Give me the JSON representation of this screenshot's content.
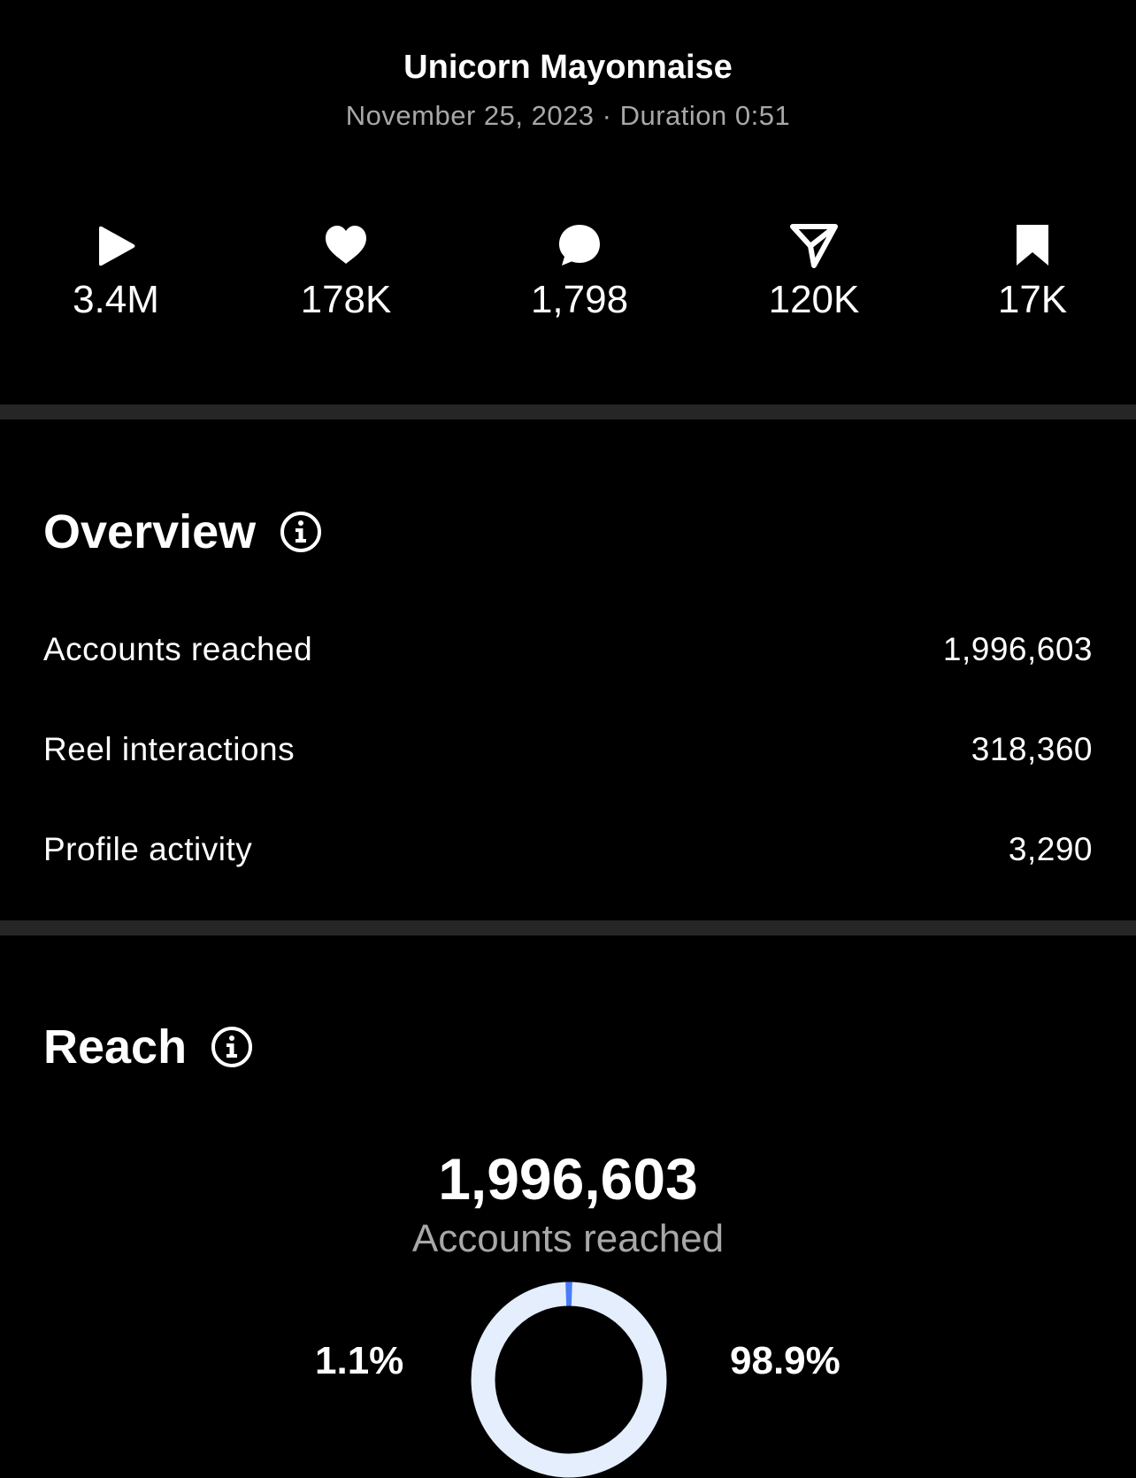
{
  "header": {
    "title": "Unicorn Mayonnaise",
    "subtitle": "November 25, 2023 · Duration 0:51"
  },
  "stats": [
    {
      "icon": "play-icon",
      "value": "3.4M"
    },
    {
      "icon": "heart-icon",
      "value": "178K"
    },
    {
      "icon": "comment-icon",
      "value": "1,798"
    },
    {
      "icon": "share-icon",
      "value": "120K"
    },
    {
      "icon": "bookmark-icon",
      "value": "17K"
    }
  ],
  "overview": {
    "title": "Overview",
    "rows": [
      {
        "label": "Accounts reached",
        "value": "1,996,603"
      },
      {
        "label": "Reel interactions",
        "value": "318,360"
      },
      {
        "label": "Profile activity",
        "value": "3,290"
      }
    ]
  },
  "reach": {
    "title": "Reach",
    "total": "1,996,603",
    "total_label": "Accounts reached",
    "left_percent": "1.1%",
    "right_percent": "98.9%",
    "donut": {
      "followers_fraction": 0.011,
      "non_followers_fraction": 0.989,
      "followers_color": "#4a7cf7",
      "non_followers_color": "#e4eefc"
    }
  }
}
